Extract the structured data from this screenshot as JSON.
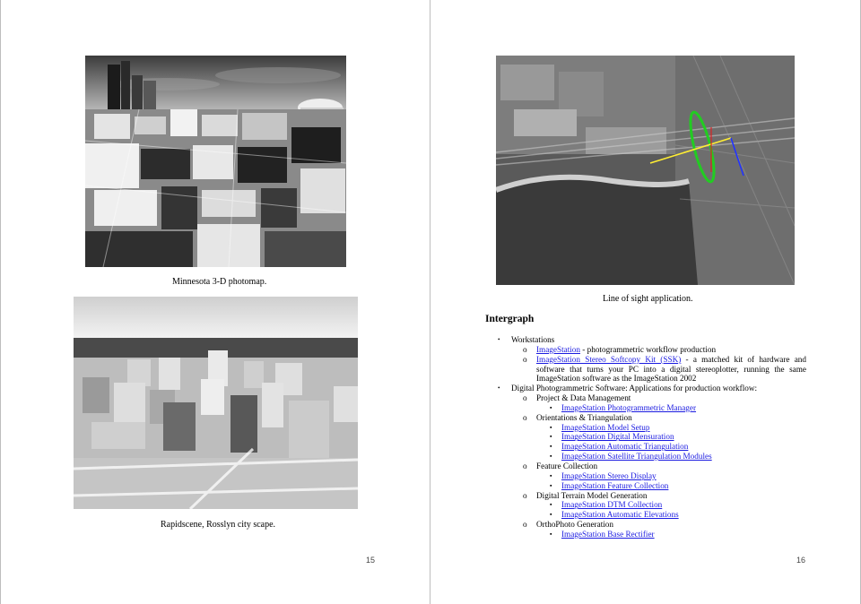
{
  "left_page": {
    "photo1_caption": "Minnesota 3-D photomap.",
    "photo2_caption": "Rapidscene, Rosslyn city scape.",
    "page_number": "15"
  },
  "right_page": {
    "photo_caption": "Line of sight application.",
    "heading": "Intergraph",
    "page_number": "16",
    "markers": {
      "bullet": "•",
      "circle": "o",
      "square": "▪"
    },
    "outline": {
      "workstations": "Workstations",
      "ws1_link": "ImageStation",
      "ws1_rest": " - photogrammetric workflow production",
      "ws2_link": "ImageStation Stereo Softcopy Kit (SSK)",
      "ws2_rest": " - a matched kit of hardware and software that turns your PC into a digital stereoplotter, running the same ImageStation software as the ImageStation 2002",
      "software": "Digital Photogrammetric Software: Applications for production workflow:",
      "pdm": "Project & Data Management",
      "pdm_1": "ImageStation Photogrammetric Manager",
      "ot": "Orientations & Triangulation",
      "ot_1": "ImageStation Model Setup",
      "ot_2": "ImageStation Digital Mensuration",
      "ot_3": "ImageStation Automatic Triangulation",
      "ot_4": "ImageStation Satellite Triangulation Modules",
      "fc": "Feature Collection",
      "fc_1": "ImageStation Stereo Display",
      "fc_2": "ImageStation Feature Collection",
      "dtm": "Digital Terrain Model Generation",
      "dtm_1": "ImageStation DTM Collection",
      "dtm_2": "ImageStation Automatic Elevations",
      "ortho": "OrthoPhoto Generation",
      "ortho_1": "ImageStation Base Rectifier"
    }
  }
}
